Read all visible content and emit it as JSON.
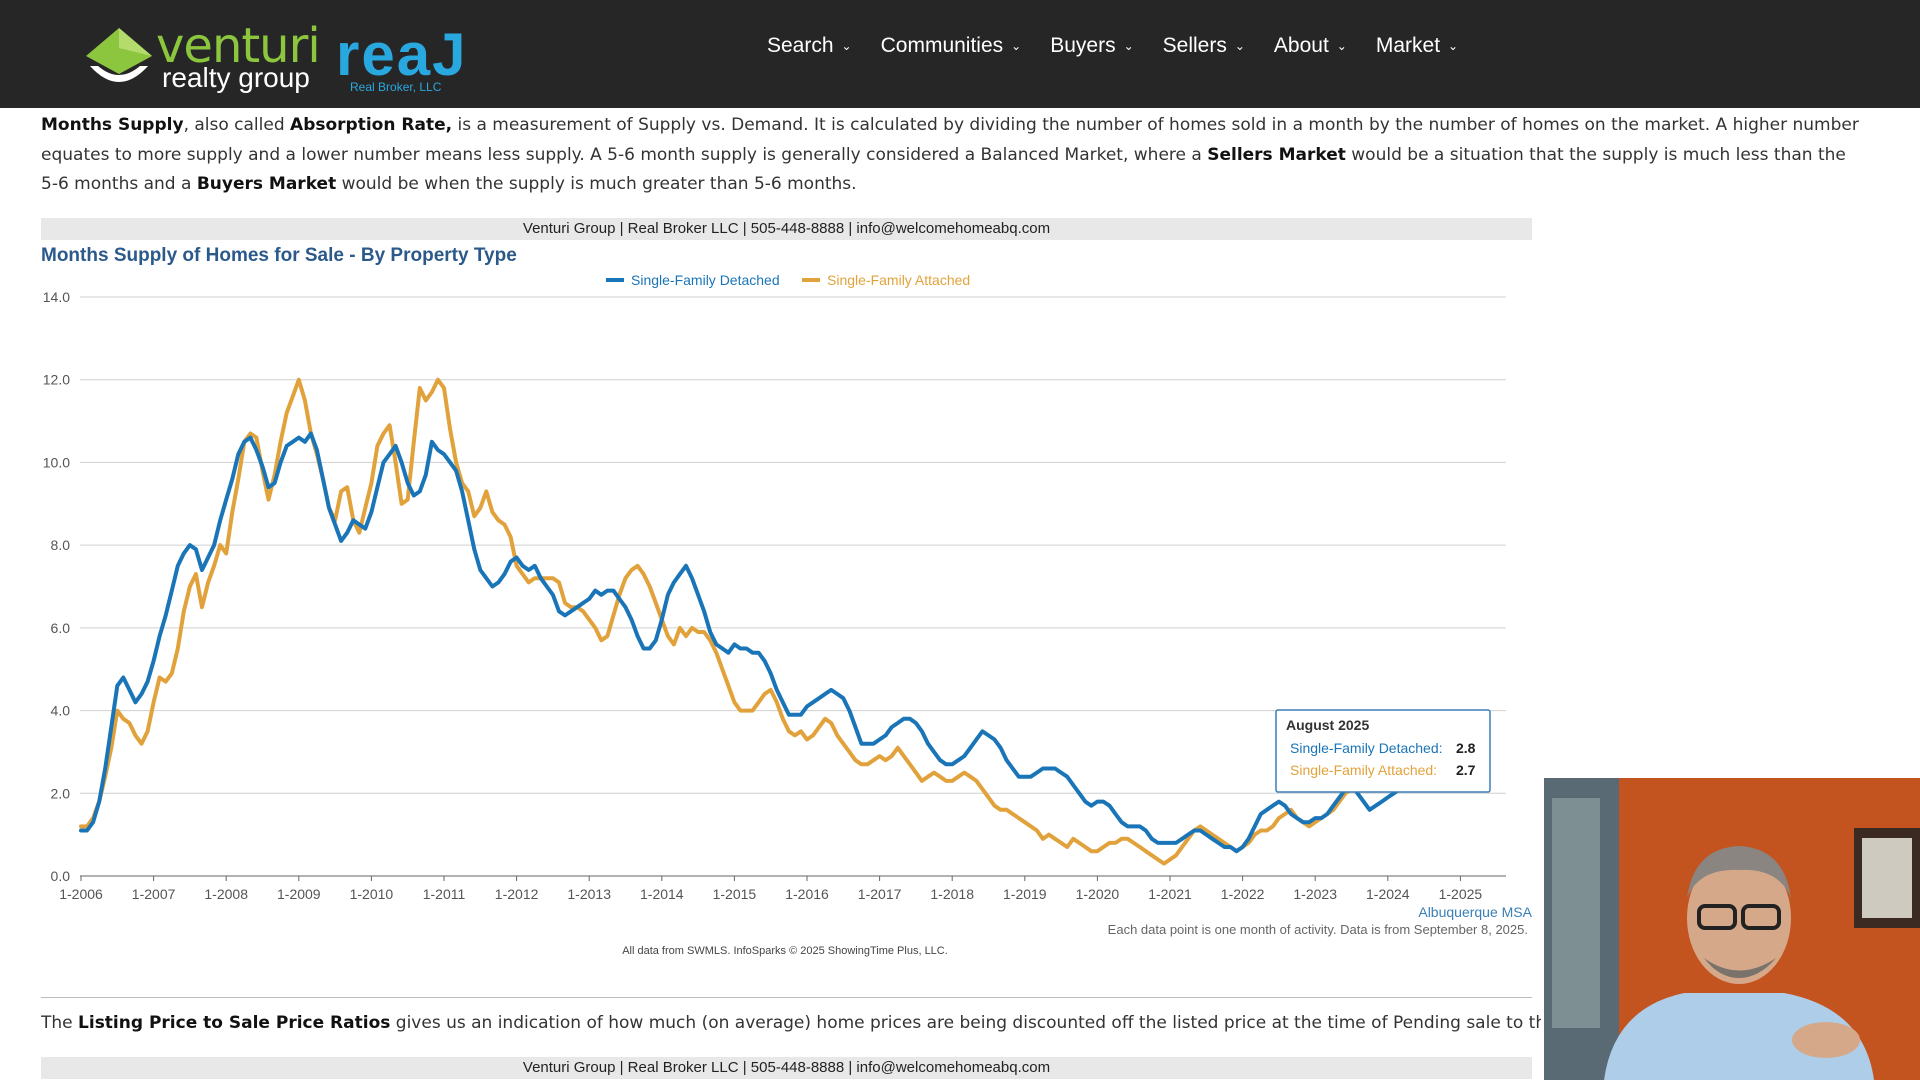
{
  "header": {
    "logo": {
      "brand": "venturi",
      "sub": "realty group",
      "real": "reaJ",
      "broker": "Real Broker, LLC"
    },
    "nav": [
      {
        "label": "Search"
      },
      {
        "label": "Communities"
      },
      {
        "label": "Buyers"
      },
      {
        "label": "Sellers"
      },
      {
        "label": "About"
      },
      {
        "label": "Market"
      }
    ]
  },
  "intro": {
    "p1_bold1": "Months Supply",
    "p1_t1": ", also called ",
    "p1_bold2": "Absorption Rate,",
    "p1_t2": " is a measurement of Supply vs. Demand. It is calculated by dividing the number of homes sold in a month by the number of homes on the market. A higher number equates to more supply and a lower number means less supply. A 5-6 month supply is generally considered a Balanced Market, where a ",
    "p1_bold3": "Sellers Market",
    "p1_t3": " would be a situation that the supply is much less than the 5-6 months and a ",
    "p1_bold4": "Buyers Market",
    "p1_t4": " would be when the supply is much greater than 5-6 months."
  },
  "banner1": "Venturi Group | Real Broker LLC | 505-448-8888 | info@welcomehomeabq.com",
  "banner2": "Venturi Group | Real Broker LLC | 505-448-8888 | info@welcomehomeabq.com",
  "second": {
    "t1": "The ",
    "bold": "Listing Price to Sale Price Ratios",
    "t2": " gives us an indication of how much (on average) home prices are being discounted off the listed price at the time of Pending sale to the final Closed"
  },
  "chart_data": {
    "type": "line",
    "title": "Months Supply of Homes for Sale - By Property Type",
    "region_label": "Albuquerque MSA",
    "note": "Each data point is one month of activity. Data is from September 8, 2025.",
    "source": "All data from SWMLS. InfoSparks © 2025 ShowingTime Plus, LLC.",
    "legend_position": "top-center",
    "grid": true,
    "ylim": [
      0,
      14
    ],
    "yticks": [
      "0.0",
      "2.0",
      "4.0",
      "6.0",
      "8.0",
      "10.0",
      "12.0",
      "14.0"
    ],
    "xticks": [
      "1-2006",
      "1-2007",
      "1-2008",
      "1-2009",
      "1-2010",
      "1-2011",
      "1-2012",
      "1-2013",
      "1-2014",
      "1-2015",
      "1-2016",
      "1-2017",
      "1-2018",
      "1-2019",
      "1-2020",
      "1-2021",
      "1-2022",
      "1-2023",
      "1-2024",
      "1-2025"
    ],
    "x_start": "2006-01",
    "colors": {
      "detached": "#1a75b8",
      "attached": "#e2a23b"
    },
    "series": [
      {
        "name": "Single-Family Detached",
        "color": "#1a75b8",
        "values": [
          1.1,
          1.1,
          1.3,
          1.8,
          2.6,
          3.6,
          4.6,
          4.8,
          4.5,
          4.2,
          4.4,
          4.7,
          5.2,
          5.8,
          6.3,
          6.9,
          7.5,
          7.8,
          8.0,
          7.9,
          7.4,
          7.7,
          8.0,
          8.6,
          9.1,
          9.6,
          10.2,
          10.5,
          10.6,
          10.3,
          9.9,
          9.4,
          9.5,
          10.0,
          10.4,
          10.5,
          10.6,
          10.5,
          10.7,
          10.3,
          9.6,
          8.9,
          8.5,
          8.1,
          8.3,
          8.6,
          8.5,
          8.4,
          8.8,
          9.4,
          10.0,
          10.2,
          10.4,
          10.0,
          9.5,
          9.2,
          9.3,
          9.7,
          10.5,
          10.3,
          10.2,
          10.0,
          9.8,
          9.3,
          8.6,
          7.9,
          7.4,
          7.2,
          7.0,
          7.1,
          7.3,
          7.6,
          7.7,
          7.5,
          7.4,
          7.5,
          7.2,
          7.0,
          6.8,
          6.4,
          6.3,
          6.4,
          6.5,
          6.6,
          6.7,
          6.9,
          6.8,
          6.9,
          6.9,
          6.7,
          6.5,
          6.2,
          5.8,
          5.5,
          5.5,
          5.7,
          6.2,
          6.8,
          7.1,
          7.3,
          7.5,
          7.2,
          6.8,
          6.4,
          5.9,
          5.6,
          5.5,
          5.4,
          5.6,
          5.5,
          5.5,
          5.4,
          5.4,
          5.2,
          4.9,
          4.5,
          4.2,
          3.9,
          3.9,
          3.9,
          4.1,
          4.2,
          4.3,
          4.4,
          4.5,
          4.4,
          4.3,
          4.0,
          3.6,
          3.2,
          3.2,
          3.2,
          3.3,
          3.4,
          3.6,
          3.7,
          3.8,
          3.8,
          3.7,
          3.5,
          3.2,
          3.0,
          2.8,
          2.7,
          2.7,
          2.8,
          2.9,
          3.1,
          3.3,
          3.5,
          3.4,
          3.3,
          3.1,
          2.8,
          2.6,
          2.4,
          2.4,
          2.4,
          2.5,
          2.6,
          2.6,
          2.6,
          2.5,
          2.4,
          2.2,
          2.0,
          1.8,
          1.7,
          1.8,
          1.8,
          1.7,
          1.5,
          1.3,
          1.2,
          1.2,
          1.2,
          1.1,
          0.9,
          0.8,
          0.8,
          0.8,
          0.8,
          0.9,
          1.0,
          1.1,
          1.1,
          1.0,
          0.9,
          0.8,
          0.7,
          0.7,
          0.6,
          0.7,
          0.9,
          1.2,
          1.5,
          1.6,
          1.7,
          1.8,
          1.7,
          1.5,
          1.4,
          1.3,
          1.3,
          1.4,
          1.4,
          1.5,
          1.7,
          1.9,
          2.1,
          2.2,
          2.0,
          1.8,
          1.6,
          1.7,
          1.8,
          1.9,
          2.0,
          2.1,
          2.2,
          2.3,
          2.4,
          2.5,
          2.6,
          2.7,
          2.8,
          2.8,
          2.9,
          2.8,
          2.8
        ]
      },
      {
        "name": "Single-Family Attached",
        "color": "#e2a23b",
        "values": [
          1.2,
          1.2,
          1.4,
          1.8,
          2.4,
          3.1,
          4.0,
          3.8,
          3.7,
          3.4,
          3.2,
          3.5,
          4.2,
          4.8,
          4.7,
          4.9,
          5.5,
          6.4,
          7.0,
          7.3,
          6.5,
          7.1,
          7.5,
          8.0,
          7.8,
          8.8,
          9.6,
          10.5,
          10.7,
          10.6,
          9.8,
          9.1,
          9.7,
          10.5,
          11.2,
          11.6,
          12.0,
          11.5,
          10.7,
          10.2,
          9.6,
          8.9,
          8.6,
          9.3,
          9.4,
          8.6,
          8.3,
          8.9,
          9.5,
          10.4,
          10.7,
          10.9,
          10.0,
          9.0,
          9.1,
          10.5,
          11.8,
          11.5,
          11.7,
          12.0,
          11.8,
          10.8,
          10.0,
          9.5,
          9.3,
          8.7,
          8.9,
          9.3,
          8.8,
          8.6,
          8.5,
          8.2,
          7.5,
          7.3,
          7.1,
          7.2,
          7.2,
          7.2,
          7.2,
          7.1,
          6.6,
          6.5,
          6.5,
          6.4,
          6.2,
          6.0,
          5.7,
          5.8,
          6.3,
          6.8,
          7.2,
          7.4,
          7.5,
          7.3,
          7.0,
          6.6,
          6.2,
          5.8,
          5.6,
          6.0,
          5.8,
          6.0,
          5.9,
          5.9,
          5.7,
          5.4,
          5.0,
          4.6,
          4.2,
          4.0,
          4.0,
          4.0,
          4.2,
          4.4,
          4.5,
          4.2,
          3.8,
          3.5,
          3.4,
          3.5,
          3.3,
          3.4,
          3.6,
          3.8,
          3.7,
          3.4,
          3.2,
          3.0,
          2.8,
          2.7,
          2.7,
          2.8,
          2.9,
          2.8,
          2.9,
          3.1,
          2.9,
          2.7,
          2.5,
          2.3,
          2.4,
          2.5,
          2.4,
          2.3,
          2.3,
          2.4,
          2.5,
          2.4,
          2.3,
          2.1,
          1.9,
          1.7,
          1.6,
          1.6,
          1.5,
          1.4,
          1.3,
          1.2,
          1.1,
          0.9,
          1.0,
          0.9,
          0.8,
          0.7,
          0.9,
          0.8,
          0.7,
          0.6,
          0.6,
          0.7,
          0.8,
          0.8,
          0.9,
          0.9,
          0.8,
          0.7,
          0.6,
          0.5,
          0.4,
          0.3,
          0.4,
          0.5,
          0.7,
          0.9,
          1.1,
          1.2,
          1.1,
          1.0,
          0.9,
          0.8,
          0.7,
          0.6,
          0.7,
          0.8,
          1.0,
          1.1,
          1.1,
          1.2,
          1.4,
          1.5,
          1.6,
          1.4,
          1.3,
          1.2,
          1.3,
          1.4,
          1.5,
          1.6,
          1.8,
          2.0,
          2.1,
          2.2,
          2.4,
          2.5,
          2.6,
          2.7,
          2.7,
          2.6,
          2.7
        ]
      }
    ],
    "tooltip": {
      "title": "August 2025",
      "rows": [
        {
          "label": "Single-Family Detached:",
          "value": "2.8"
        },
        {
          "label": "Single-Family Attached:",
          "value": "2.7"
        }
      ]
    }
  }
}
